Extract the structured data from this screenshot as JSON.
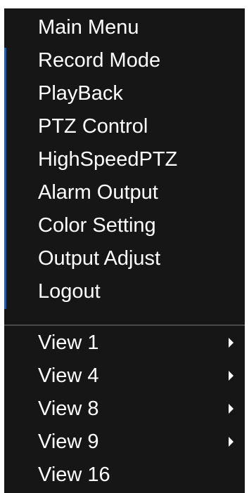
{
  "menu": {
    "items": [
      {
        "label": "Main Menu"
      },
      {
        "label": "Record Mode"
      },
      {
        "label": "PlayBack"
      },
      {
        "label": "PTZ Control"
      },
      {
        "label": "HighSpeedPTZ"
      },
      {
        "label": "Alarm Output"
      },
      {
        "label": "Color Setting"
      },
      {
        "label": "Output Adjust"
      },
      {
        "label": "Logout"
      }
    ],
    "views": [
      {
        "label": "View 1",
        "has_submenu": true
      },
      {
        "label": "View 4",
        "has_submenu": true
      },
      {
        "label": "View 8",
        "has_submenu": true
      },
      {
        "label": "View 9",
        "has_submenu": true
      },
      {
        "label": "View 16",
        "has_submenu": false
      }
    ]
  },
  "colors": {
    "menu_background": "#161616",
    "text": "#ffffff",
    "accent": "#1a5fb4",
    "separator": "#4a4a4a"
  }
}
